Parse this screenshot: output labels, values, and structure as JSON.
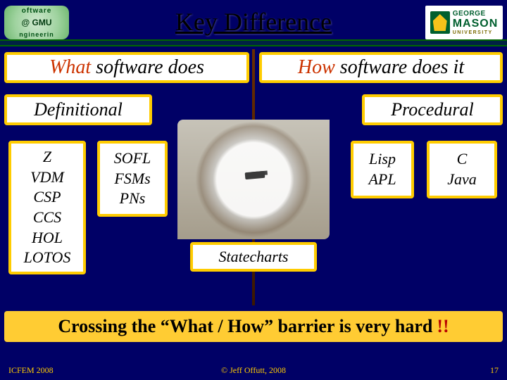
{
  "title": "Key Difference",
  "logo_left": {
    "top": "oftware",
    "center": "@ GMU",
    "bottom": "ngineerin"
  },
  "logo_right": {
    "line1": "GEORGE",
    "line2": "MASON",
    "line3": "UNIVERSITY"
  },
  "boxes": {
    "what": {
      "red": "What",
      "rest": " software does"
    },
    "how": {
      "red": "How",
      "rest": " software does it"
    },
    "definitional": "Definitional",
    "procedural": "Procedural",
    "left_list": "Z\nVDM\nCSP\nCCS\nHOL\nLOTOS",
    "left_list_2": "SOFL\nFSMs\nPNs",
    "statecharts": "Statecharts",
    "right_list": "Lisp\nAPL",
    "right_list_2": "C\nJava"
  },
  "crossing": {
    "main": "Crossing the “What / How” barrier is very hard",
    "punch": " !!"
  },
  "footer": {
    "left": "ICFEM 2008",
    "center": "© Jeff Offutt, 2008",
    "right": "17"
  }
}
